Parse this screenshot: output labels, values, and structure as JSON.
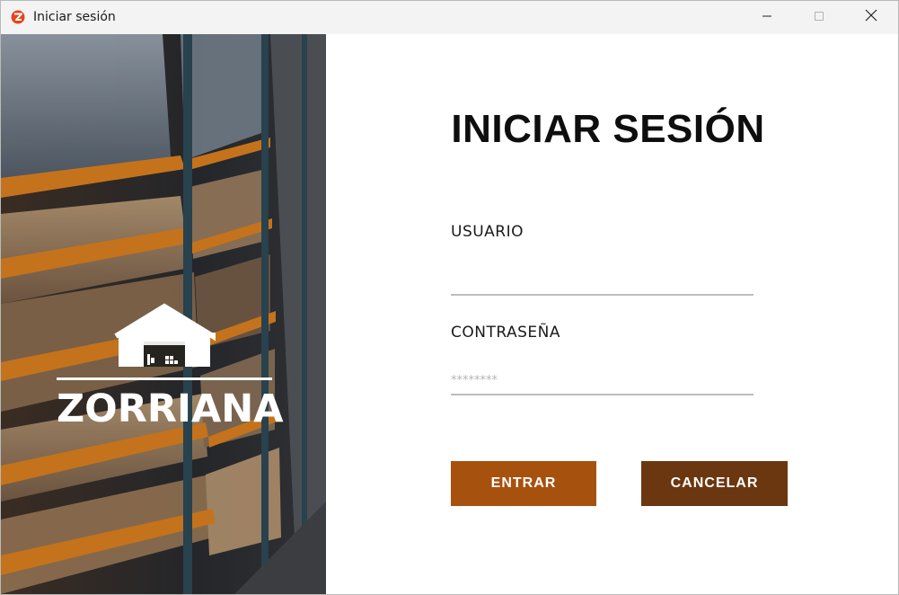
{
  "window": {
    "title": "Iniciar sesión",
    "icon": "z-logo-icon",
    "controls": [
      "minimize-icon",
      "maximize-icon",
      "close-icon"
    ]
  },
  "hero": {
    "image": "warehouse-shelves-photo",
    "logo_icon": "warehouse-icon",
    "brand_name": "ZORRIANA"
  },
  "form": {
    "title": "INICIAR SESIÓN",
    "user_label": "USUARIO",
    "user_value": "",
    "user_placeholder": "",
    "password_label": "CONTRASEÑA",
    "password_value": "",
    "password_placeholder": "********",
    "enter_label": "ENTRAR",
    "cancel_label": "CANCELAR"
  },
  "colors": {
    "enter_button": "#a7510f",
    "cancel_button": "#6b3710",
    "app_icon": "#e8431b"
  }
}
